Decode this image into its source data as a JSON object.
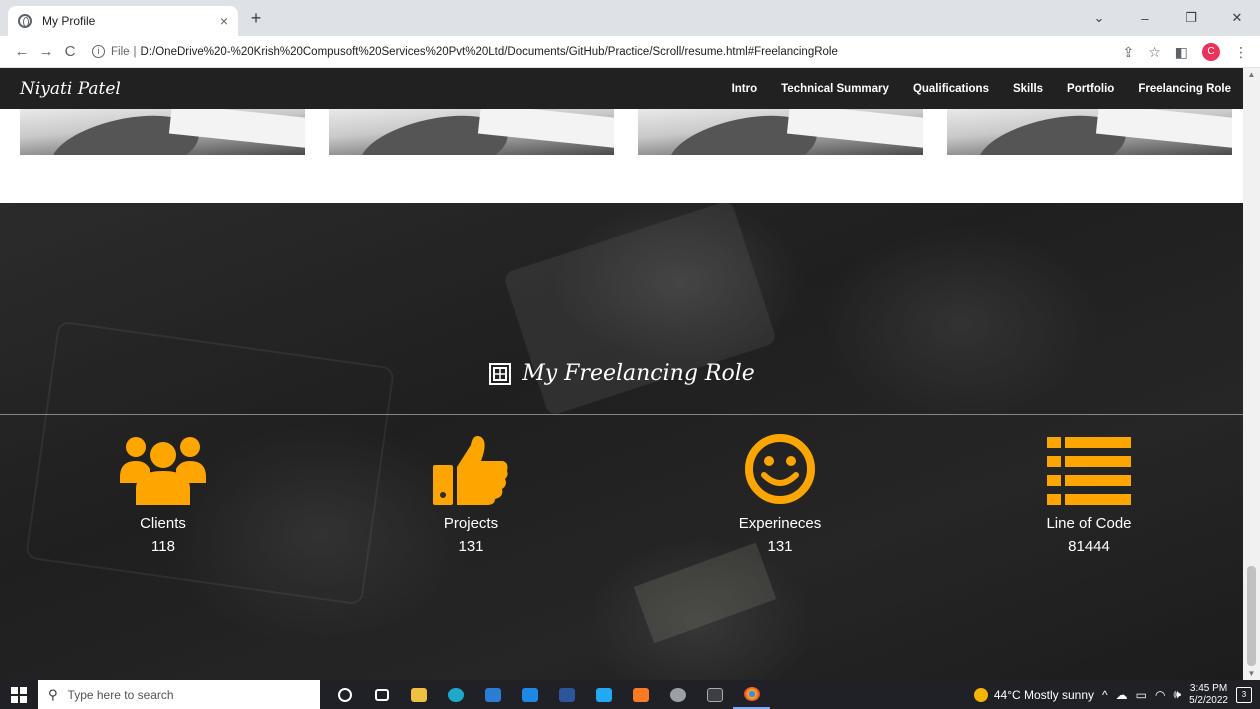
{
  "browser": {
    "tab_title": "My Profile",
    "tab_close": "×",
    "new_tab": "+",
    "url_scheme": "File",
    "url_sep": "|",
    "url": "D:/OneDrive%20-%20Krish%20Compusoft%20Services%20Pvt%20Ltd/Documents/GitHub/Practice/Scroll/resume.html#FreelancingRole",
    "profile_initial": "C",
    "win_minimize": "–",
    "win_restore": "❐",
    "win_close": "✕",
    "win_menu": "⌄"
  },
  "site": {
    "brand": "Niyati Patel",
    "menu": [
      "Intro",
      "Technical Summary",
      "Qualifications",
      "Skills",
      "Portfolio",
      "Freelancing Role"
    ]
  },
  "freelancing": {
    "title": "My Freelancing Role",
    "stats": [
      {
        "label": "Clients",
        "value": "118",
        "icon": "users-icon"
      },
      {
        "label": "Projects",
        "value": "131",
        "icon": "thumbs-up-icon"
      },
      {
        "label": "Experineces",
        "value": "131",
        "icon": "smile-icon"
      },
      {
        "label": "Line of Code",
        "value": "81444",
        "icon": "list-icon"
      }
    ],
    "accent": "#ffa500"
  },
  "taskbar": {
    "search_placeholder": "Type here to search",
    "weather": "44°C  Mostly sunny",
    "time": "3:45 PM",
    "date": "5/2/2022",
    "notifications": "3"
  }
}
